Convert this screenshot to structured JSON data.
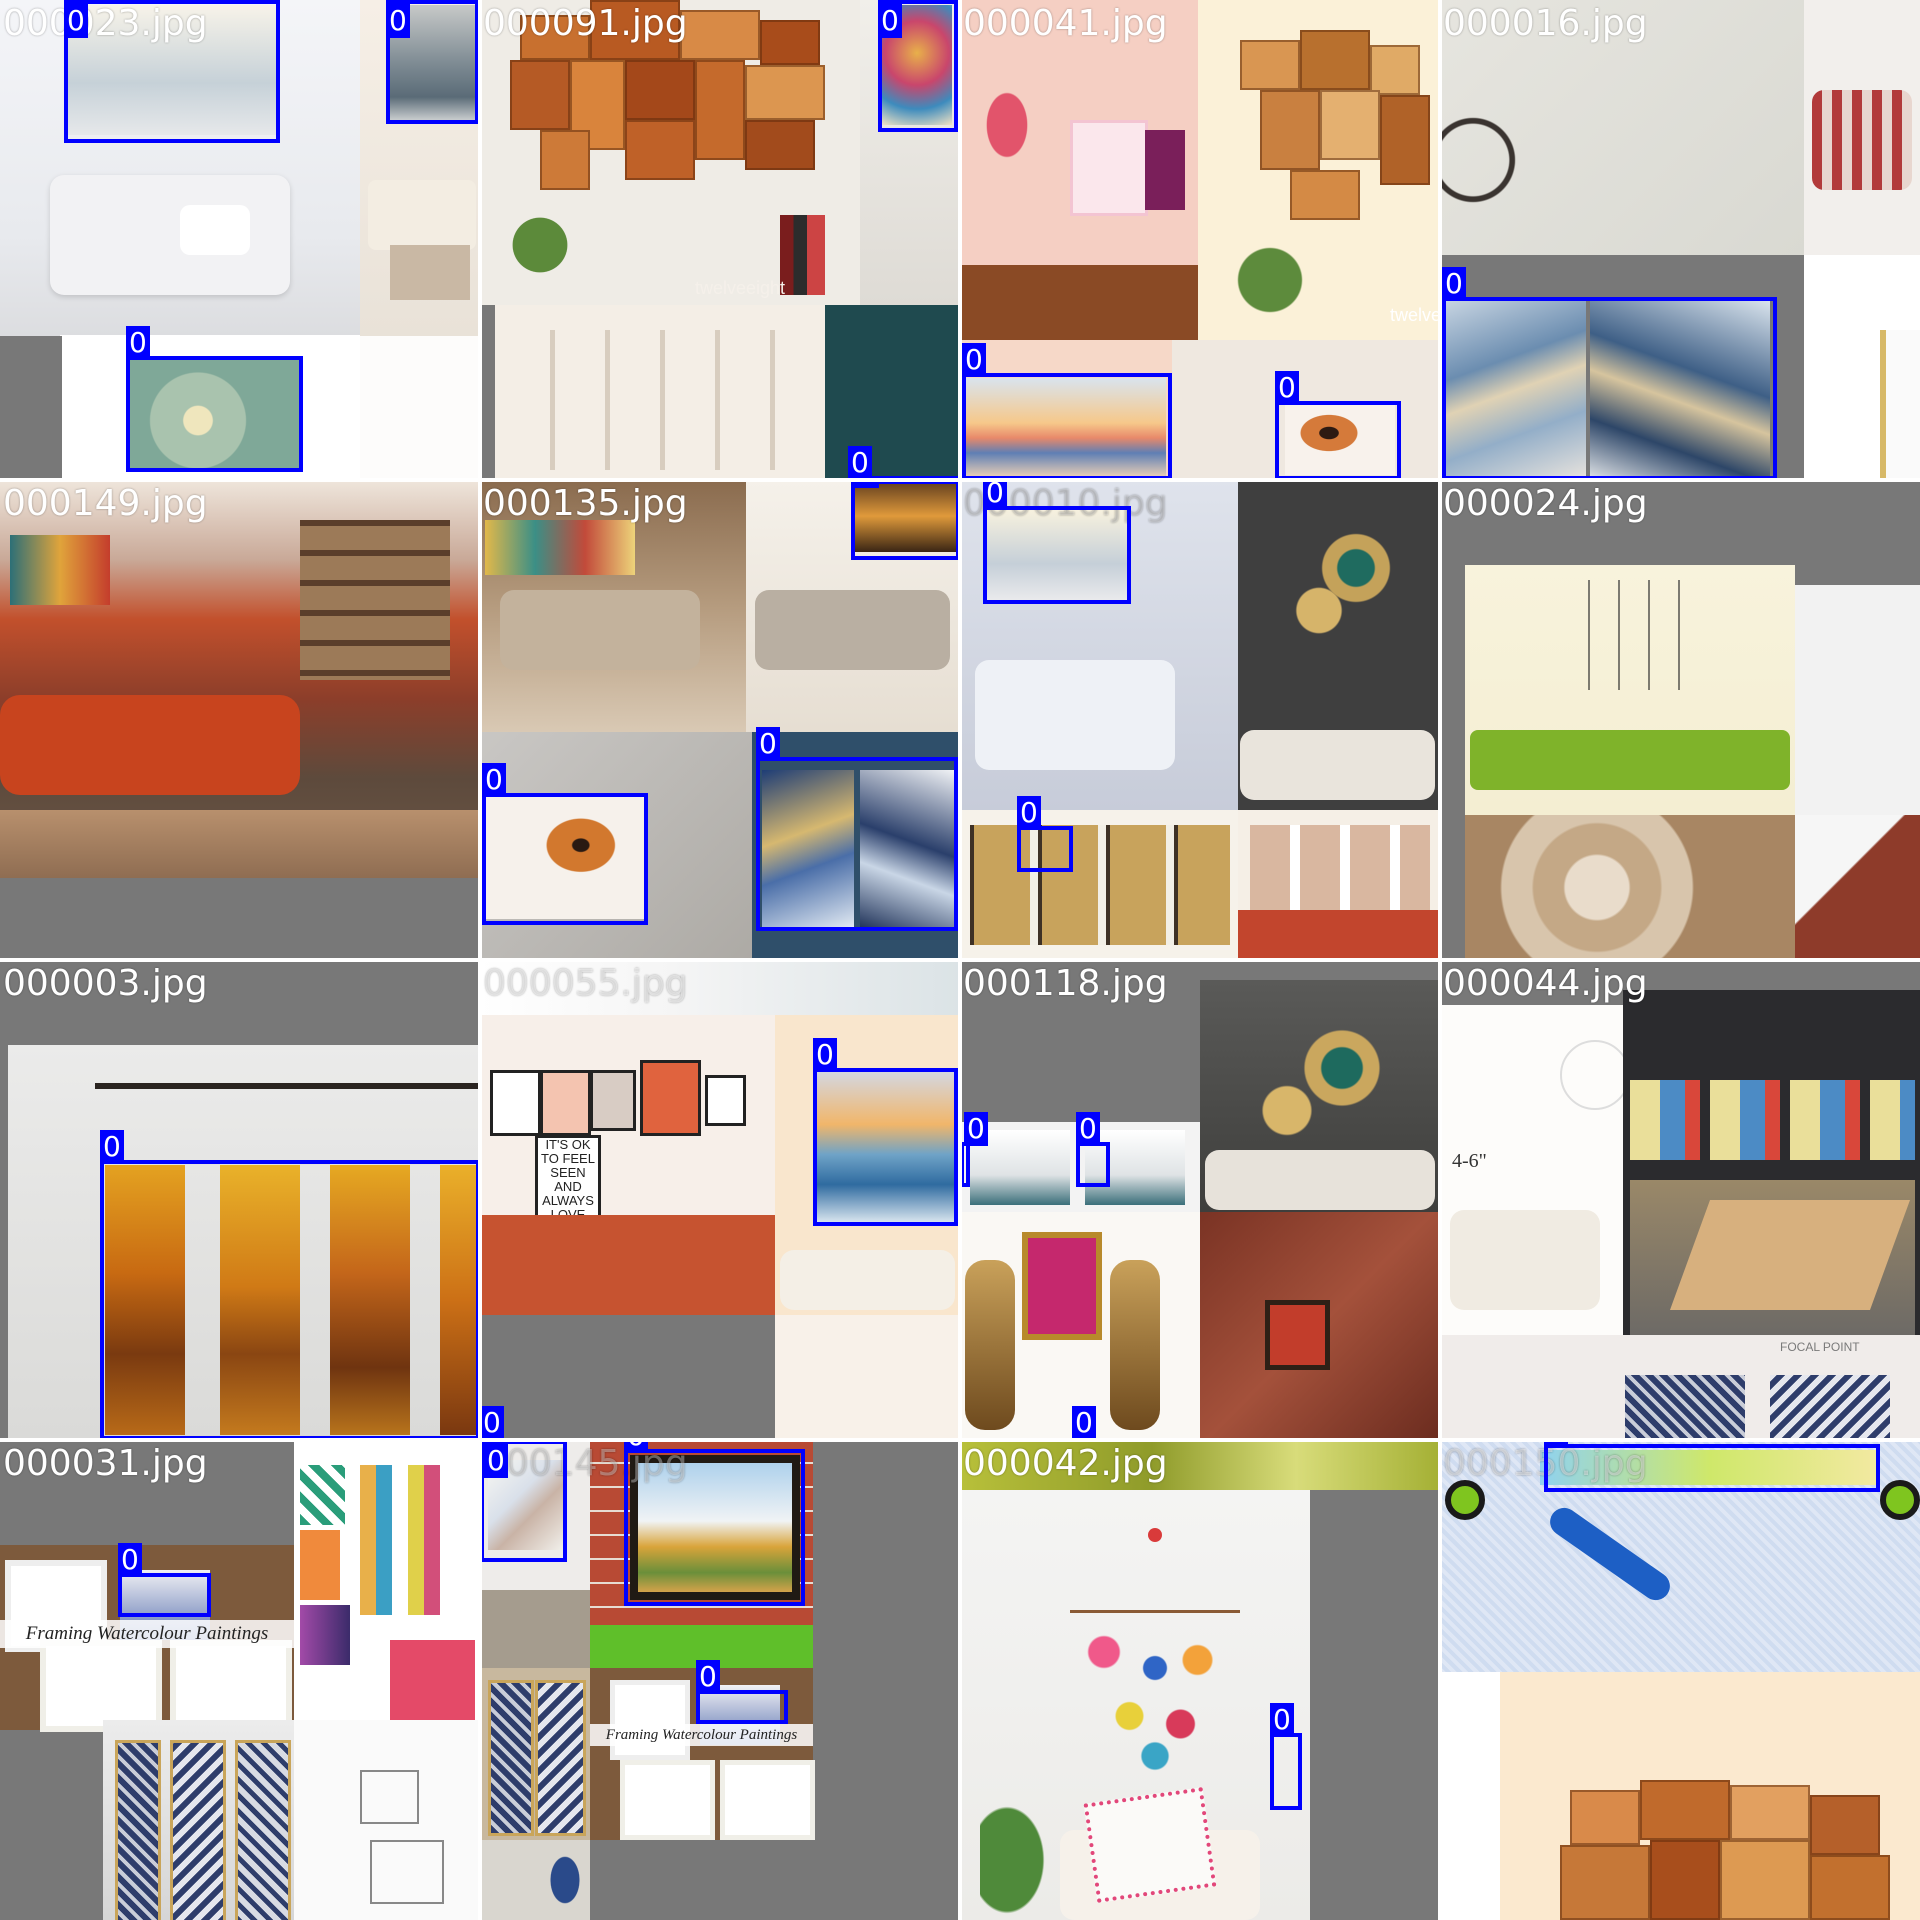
{
  "tiles": [
    {
      "filename": "000023.jpg",
      "boxes": [
        "0",
        "0",
        "0"
      ]
    },
    {
      "filename": "000091.jpg",
      "boxes": [
        "0",
        "0"
      ]
    },
    {
      "filename": "000041.jpg",
      "boxes": [
        "0",
        "0"
      ]
    },
    {
      "filename": "000016.jpg",
      "boxes": [
        "0"
      ]
    },
    {
      "filename": "000149.jpg",
      "boxes": []
    },
    {
      "filename": "000135.jpg",
      "boxes": [
        "0",
        "0",
        "0"
      ]
    },
    {
      "filename": "000010.jpg",
      "boxes": [
        "0",
        "0"
      ]
    },
    {
      "filename": "000024.jpg",
      "boxes": []
    },
    {
      "filename": "000003.jpg",
      "boxes": [
        "0"
      ]
    },
    {
      "filename": "000055.jpg",
      "boxes": [
        "0",
        "0"
      ]
    },
    {
      "filename": "000118.jpg",
      "boxes": [
        "0",
        "0",
        "0"
      ]
    },
    {
      "filename": "000044.jpg",
      "boxes": []
    },
    {
      "filename": "000031.jpg",
      "boxes": [
        "0"
      ]
    },
    {
      "filename": "000145.jpg",
      "boxes": [
        "0",
        "0",
        "0"
      ]
    },
    {
      "filename": "000042.jpg",
      "boxes": [
        "0"
      ]
    },
    {
      "filename": "000150.jpg",
      "boxes": [
        "0"
      ]
    }
  ],
  "scene_text": {
    "watermark": "twelveeight",
    "watermark_2": "twelve",
    "height_note": "4-6\"",
    "framing_caption": "Framing Watercolour Paintings",
    "focal_point_tag": "FOCAL POINT",
    "poster_words": "IT'S OK TO FEEL SEEN AND ALWAYS LOVE YOU"
  },
  "colors": {
    "box": "#0000ff",
    "label_text": "#ffffff",
    "pad": "#787878",
    "separator": "#ffffff"
  }
}
